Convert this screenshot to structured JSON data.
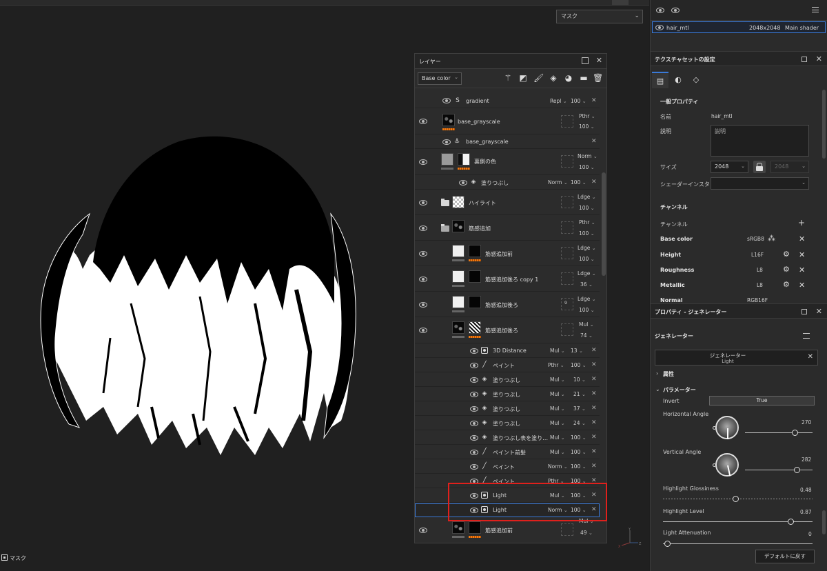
{
  "viewport": {
    "mask_select": "マスク",
    "bottom_label": "マスク",
    "axis": {
      "x": "X",
      "y": "Y",
      "z": "Z"
    }
  },
  "layers_panel": {
    "title": "レイヤー",
    "channel_select": "Base color",
    "rows": [
      {
        "name": "gradient",
        "blend": "Repl",
        "opacity": "100"
      },
      {
        "name": "base_grayscale",
        "blend": "Pthr",
        "opacity": "100"
      },
      {
        "name": "base_grayscale"
      },
      {
        "name": "裏側の色",
        "blend": "Norm",
        "opacity": "100"
      },
      {
        "name": "塗りつぶし",
        "blend": "Norm",
        "opacity": "100"
      },
      {
        "name": "ハイライト",
        "blend": "Ldge",
        "opacity": "100"
      },
      {
        "name": "筋感追加",
        "blend": "Pthr",
        "opacity": "100"
      },
      {
        "name": "筋感追加前",
        "blend": "Ldge",
        "opacity": "100"
      },
      {
        "name": "筋感追加後ろ copy 1",
        "blend": "Ldge",
        "opacity": "36"
      },
      {
        "name": "筋感追加後ろ",
        "blend": "Ldge",
        "opacity": "100",
        "badge": "9"
      },
      {
        "name": "筋感追加後ろ",
        "blend": "Mul",
        "opacity": "74"
      },
      {
        "name": "3D Distance",
        "blend": "Mul",
        "opacity": "13"
      },
      {
        "name": "ペイント",
        "blend": "Pthr",
        "opacity": "100"
      },
      {
        "name": "塗りつぶし",
        "blend": "Mul",
        "opacity": "10"
      },
      {
        "name": "塗りつぶし",
        "blend": "Mul",
        "opacity": "21"
      },
      {
        "name": "塗りつぶし",
        "blend": "Mul",
        "opacity": "37"
      },
      {
        "name": "塗りつぶし",
        "blend": "Mul",
        "opacity": "24"
      },
      {
        "name": "塗りつぶし表を塗り…",
        "blend": "Mul",
        "opacity": "100"
      },
      {
        "name": "ペイント前髪",
        "blend": "Mul",
        "opacity": "100"
      },
      {
        "name": "ペイント",
        "blend": "Norm",
        "opacity": "100"
      },
      {
        "name": "ペイント",
        "blend": "Pthr",
        "opacity": "100"
      },
      {
        "name": "Light",
        "blend": "Mul",
        "opacity": "100"
      },
      {
        "name": "Light",
        "blend": "Norm",
        "opacity": "100"
      },
      {
        "name": "筋感追加前",
        "blend": "Mul",
        "opacity": "49"
      }
    ]
  },
  "right_panel": {
    "texture_row": {
      "name": "hair_mtl",
      "size": "2048x2048",
      "shader": "Main shader"
    },
    "texset_title": "テクスチャセットの設定",
    "general_title": "一般プロパティ",
    "name_label": "名前",
    "name_value": "hair_mtl",
    "desc_label": "説明",
    "desc_placeholder": "説明",
    "size_label": "サイズ",
    "size_value": "2048",
    "size_value2": "2048",
    "shader_label": "シェーダーインスタンス",
    "channels_title": "チャンネル",
    "channels_label": "チャンネル",
    "channels": [
      {
        "name": "Base color",
        "format": "sRGB8"
      },
      {
        "name": "Height",
        "format": "L16F"
      },
      {
        "name": "Roughness",
        "format": "L8"
      },
      {
        "name": "Metallic",
        "format": "L8"
      },
      {
        "name": "Normal",
        "format": "RGB16F"
      }
    ],
    "gen_title": "プロパティ - ジェネレーター",
    "gen_section": "ジェネレーター",
    "gen_box_line1": "ジェネレーター",
    "gen_box_line2": "Light",
    "attr_label": "属性",
    "param_label": "パラメーター",
    "invert_label": "Invert",
    "invert_value": "True",
    "h_angle_label": "Horizontal Angle",
    "h_angle_value": "270",
    "v_angle_label": "Vertical Angle",
    "v_angle_value": "282",
    "gloss_label": "Highlight Glossiness",
    "gloss_value": "0.48",
    "level_label": "Highlight Level",
    "level_value": "0.87",
    "atten_label": "Light Attenuation",
    "atten_value": "0",
    "default_button": "デフォルトに戻す"
  },
  "colors": {
    "accent": "#3a7ad8",
    "highlight": "#e0201c",
    "mask": "#f07a12"
  }
}
